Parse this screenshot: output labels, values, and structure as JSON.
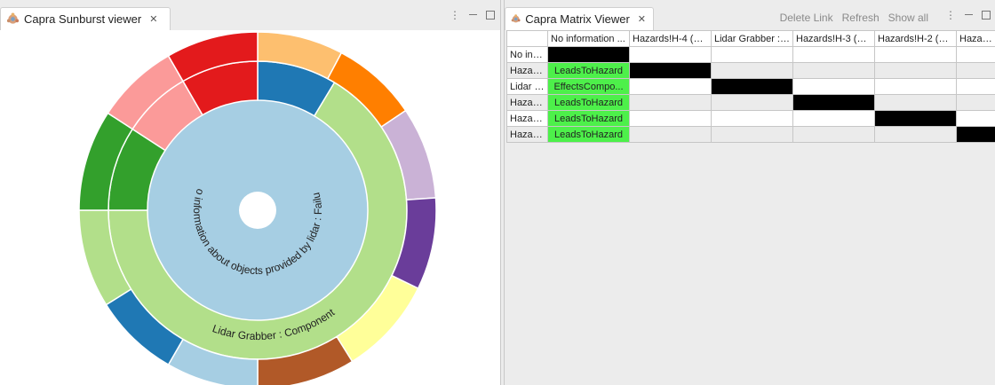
{
  "sunburst_view": {
    "title": "Capra Sunburst viewer",
    "close_glyph": "✕",
    "inner_label": "No information about objects provided by lidar : Failure",
    "middle_label": "Lidar Grabber : Component",
    "colors": {
      "inner": "#a6cee3",
      "middle": "#b2df8a",
      "blue": "#1f78b4",
      "red": "#e31a1c",
      "pink": "#fb9a99",
      "green": "#33a02c",
      "orange_light": "#fdbf6f",
      "orange": "#ff7f00",
      "lavender": "#cab2d6",
      "purple": "#6a3d9a",
      "yellow": "#ffff99",
      "brown": "#b15928"
    }
  },
  "matrix_view": {
    "title": "Capra Matrix Viewer",
    "close_glyph": "✕",
    "toolbar": {
      "delete_link": "Delete Link",
      "refresh": "Refresh",
      "show_all": "Show all"
    },
    "columns": [
      "No information ...",
      "Hazards!H-4 (m...",
      "Lidar Grabber : ...",
      "Hazards!H-3 (m...",
      "Hazards!H-2 (m...",
      "Hazards!"
    ],
    "rows": [
      {
        "label": "No info...",
        "cells": [
          "",
          "",
          "",
          "",
          "",
          ""
        ]
      },
      {
        "label": "Hazard...",
        "cells": [
          "LeadsToHazard",
          "",
          "",
          "",
          "",
          ""
        ]
      },
      {
        "label": "Lidar G...",
        "cells": [
          "EffectsCompo...",
          "",
          "",
          "",
          "",
          ""
        ]
      },
      {
        "label": "Hazard...",
        "cells": [
          "LeadsToHazard",
          "",
          "",
          "",
          "",
          ""
        ]
      },
      {
        "label": "Hazard...",
        "cells": [
          "LeadsToHazard",
          "",
          "",
          "",
          "",
          ""
        ]
      },
      {
        "label": "Hazard...",
        "cells": [
          "LeadsToHazard",
          "",
          "",
          "",
          "",
          ""
        ]
      }
    ],
    "colors": {
      "link": "#4df04a",
      "self": "#000000"
    }
  }
}
